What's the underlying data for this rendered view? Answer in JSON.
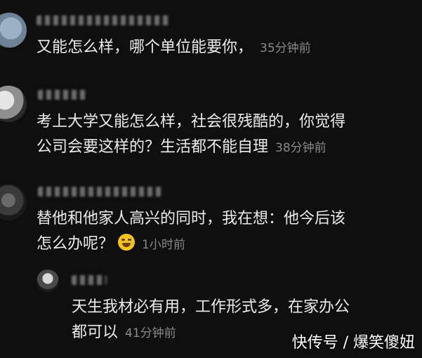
{
  "comments": [
    {
      "text": "又能怎么样，哪个单位能要你，",
      "time": "35分钟前"
    },
    {
      "line1": "考上大学又能怎么样，社会很残酷的，你觉得",
      "line2": "公司会要这样的？生活都不能自理",
      "time": "38分钟前"
    },
    {
      "line1": "替他和他家人高兴的同时，我在想：他今后该",
      "line2": "怎么办呢？",
      "emoji": "laughing-crying-emoji",
      "time": "1小时前"
    }
  ],
  "reply": {
    "line1": "天生我材必有用，工作形式多，在家办公",
    "line2": "都可以",
    "time": "41分钟前"
  },
  "watermark": "快传号 / 爆笑傻妞"
}
